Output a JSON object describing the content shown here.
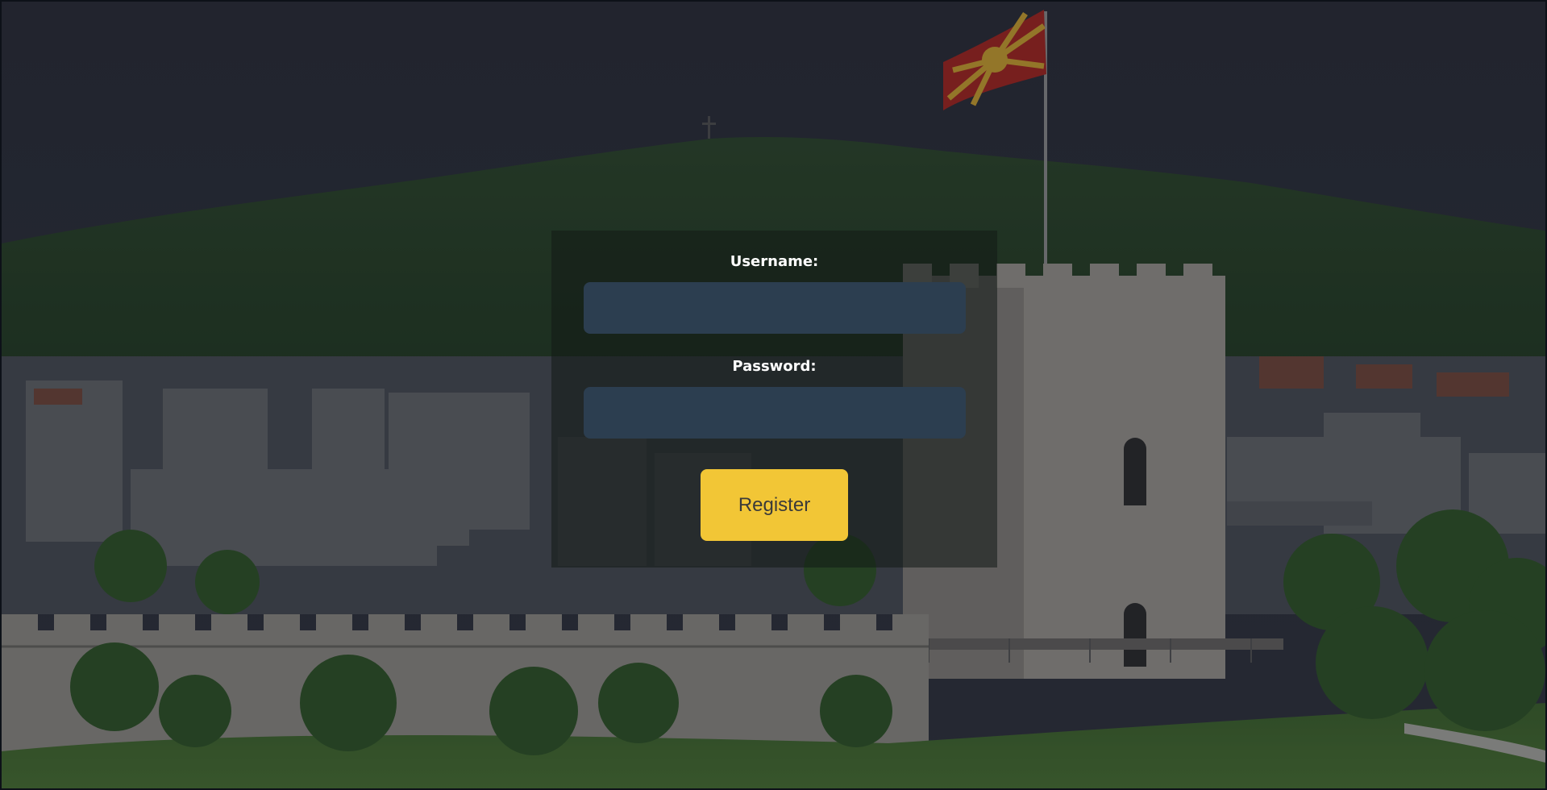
{
  "form": {
    "username_label": "Username:",
    "username_value": "",
    "password_label": "Password:",
    "password_value": "",
    "register_label": "Register"
  },
  "colors": {
    "input_background": "#2c3e50",
    "button_background": "#f2c636",
    "label_text": "#ffffff"
  }
}
